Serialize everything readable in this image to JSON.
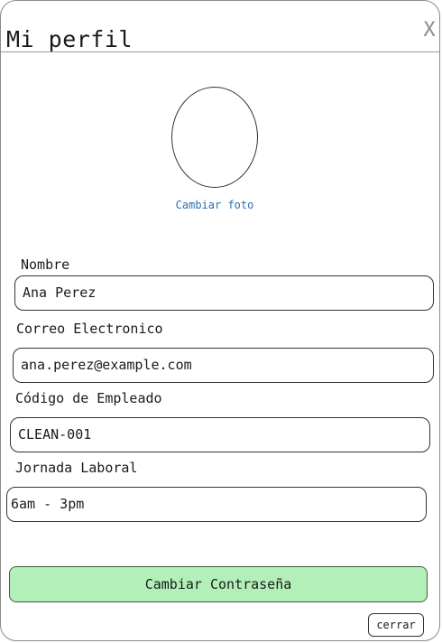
{
  "header": {
    "title": "Mi perfil",
    "close_glyph": "X"
  },
  "avatar": {
    "change_photo_label": "Cambiar foto"
  },
  "form": {
    "nombre": {
      "label": "Nombre",
      "value": "Ana Perez"
    },
    "correo": {
      "label": "Correo Electronico",
      "value": "ana.perez@example.com"
    },
    "codigo": {
      "label": "Código de Empleado",
      "value": "CLEAN-001"
    },
    "jornada": {
      "label": "Jornada Laboral",
      "value": "6am - 3pm"
    }
  },
  "actions": {
    "change_password_label": "Cambiar Contraseña",
    "close_label": "cerrar"
  },
  "colors": {
    "accent_link": "#2a6fb0",
    "primary_button_bg": "#b3f0b9"
  }
}
